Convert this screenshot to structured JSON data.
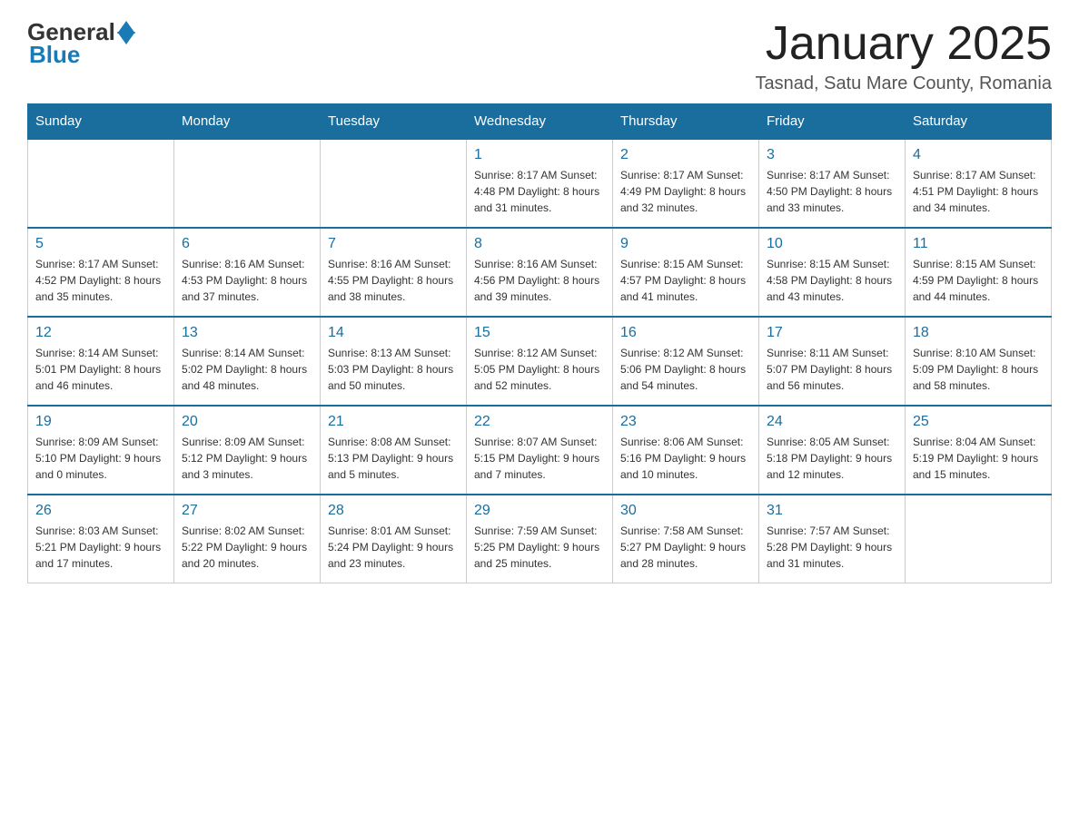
{
  "header": {
    "logo": {
      "general": "General",
      "blue": "Blue"
    },
    "title": "January 2025",
    "location": "Tasnad, Satu Mare County, Romania"
  },
  "calendar": {
    "days_of_week": [
      "Sunday",
      "Monday",
      "Tuesday",
      "Wednesday",
      "Thursday",
      "Friday",
      "Saturday"
    ],
    "weeks": [
      [
        {
          "day": "",
          "info": ""
        },
        {
          "day": "",
          "info": ""
        },
        {
          "day": "",
          "info": ""
        },
        {
          "day": "1",
          "info": "Sunrise: 8:17 AM\nSunset: 4:48 PM\nDaylight: 8 hours\nand 31 minutes."
        },
        {
          "day": "2",
          "info": "Sunrise: 8:17 AM\nSunset: 4:49 PM\nDaylight: 8 hours\nand 32 minutes."
        },
        {
          "day": "3",
          "info": "Sunrise: 8:17 AM\nSunset: 4:50 PM\nDaylight: 8 hours\nand 33 minutes."
        },
        {
          "day": "4",
          "info": "Sunrise: 8:17 AM\nSunset: 4:51 PM\nDaylight: 8 hours\nand 34 minutes."
        }
      ],
      [
        {
          "day": "5",
          "info": "Sunrise: 8:17 AM\nSunset: 4:52 PM\nDaylight: 8 hours\nand 35 minutes."
        },
        {
          "day": "6",
          "info": "Sunrise: 8:16 AM\nSunset: 4:53 PM\nDaylight: 8 hours\nand 37 minutes."
        },
        {
          "day": "7",
          "info": "Sunrise: 8:16 AM\nSunset: 4:55 PM\nDaylight: 8 hours\nand 38 minutes."
        },
        {
          "day": "8",
          "info": "Sunrise: 8:16 AM\nSunset: 4:56 PM\nDaylight: 8 hours\nand 39 minutes."
        },
        {
          "day": "9",
          "info": "Sunrise: 8:15 AM\nSunset: 4:57 PM\nDaylight: 8 hours\nand 41 minutes."
        },
        {
          "day": "10",
          "info": "Sunrise: 8:15 AM\nSunset: 4:58 PM\nDaylight: 8 hours\nand 43 minutes."
        },
        {
          "day": "11",
          "info": "Sunrise: 8:15 AM\nSunset: 4:59 PM\nDaylight: 8 hours\nand 44 minutes."
        }
      ],
      [
        {
          "day": "12",
          "info": "Sunrise: 8:14 AM\nSunset: 5:01 PM\nDaylight: 8 hours\nand 46 minutes."
        },
        {
          "day": "13",
          "info": "Sunrise: 8:14 AM\nSunset: 5:02 PM\nDaylight: 8 hours\nand 48 minutes."
        },
        {
          "day": "14",
          "info": "Sunrise: 8:13 AM\nSunset: 5:03 PM\nDaylight: 8 hours\nand 50 minutes."
        },
        {
          "day": "15",
          "info": "Sunrise: 8:12 AM\nSunset: 5:05 PM\nDaylight: 8 hours\nand 52 minutes."
        },
        {
          "day": "16",
          "info": "Sunrise: 8:12 AM\nSunset: 5:06 PM\nDaylight: 8 hours\nand 54 minutes."
        },
        {
          "day": "17",
          "info": "Sunrise: 8:11 AM\nSunset: 5:07 PM\nDaylight: 8 hours\nand 56 minutes."
        },
        {
          "day": "18",
          "info": "Sunrise: 8:10 AM\nSunset: 5:09 PM\nDaylight: 8 hours\nand 58 minutes."
        }
      ],
      [
        {
          "day": "19",
          "info": "Sunrise: 8:09 AM\nSunset: 5:10 PM\nDaylight: 9 hours\nand 0 minutes."
        },
        {
          "day": "20",
          "info": "Sunrise: 8:09 AM\nSunset: 5:12 PM\nDaylight: 9 hours\nand 3 minutes."
        },
        {
          "day": "21",
          "info": "Sunrise: 8:08 AM\nSunset: 5:13 PM\nDaylight: 9 hours\nand 5 minutes."
        },
        {
          "day": "22",
          "info": "Sunrise: 8:07 AM\nSunset: 5:15 PM\nDaylight: 9 hours\nand 7 minutes."
        },
        {
          "day": "23",
          "info": "Sunrise: 8:06 AM\nSunset: 5:16 PM\nDaylight: 9 hours\nand 10 minutes."
        },
        {
          "day": "24",
          "info": "Sunrise: 8:05 AM\nSunset: 5:18 PM\nDaylight: 9 hours\nand 12 minutes."
        },
        {
          "day": "25",
          "info": "Sunrise: 8:04 AM\nSunset: 5:19 PM\nDaylight: 9 hours\nand 15 minutes."
        }
      ],
      [
        {
          "day": "26",
          "info": "Sunrise: 8:03 AM\nSunset: 5:21 PM\nDaylight: 9 hours\nand 17 minutes."
        },
        {
          "day": "27",
          "info": "Sunrise: 8:02 AM\nSunset: 5:22 PM\nDaylight: 9 hours\nand 20 minutes."
        },
        {
          "day": "28",
          "info": "Sunrise: 8:01 AM\nSunset: 5:24 PM\nDaylight: 9 hours\nand 23 minutes."
        },
        {
          "day": "29",
          "info": "Sunrise: 7:59 AM\nSunset: 5:25 PM\nDaylight: 9 hours\nand 25 minutes."
        },
        {
          "day": "30",
          "info": "Sunrise: 7:58 AM\nSunset: 5:27 PM\nDaylight: 9 hours\nand 28 minutes."
        },
        {
          "day": "31",
          "info": "Sunrise: 7:57 AM\nSunset: 5:28 PM\nDaylight: 9 hours\nand 31 minutes."
        },
        {
          "day": "",
          "info": ""
        }
      ]
    ]
  }
}
